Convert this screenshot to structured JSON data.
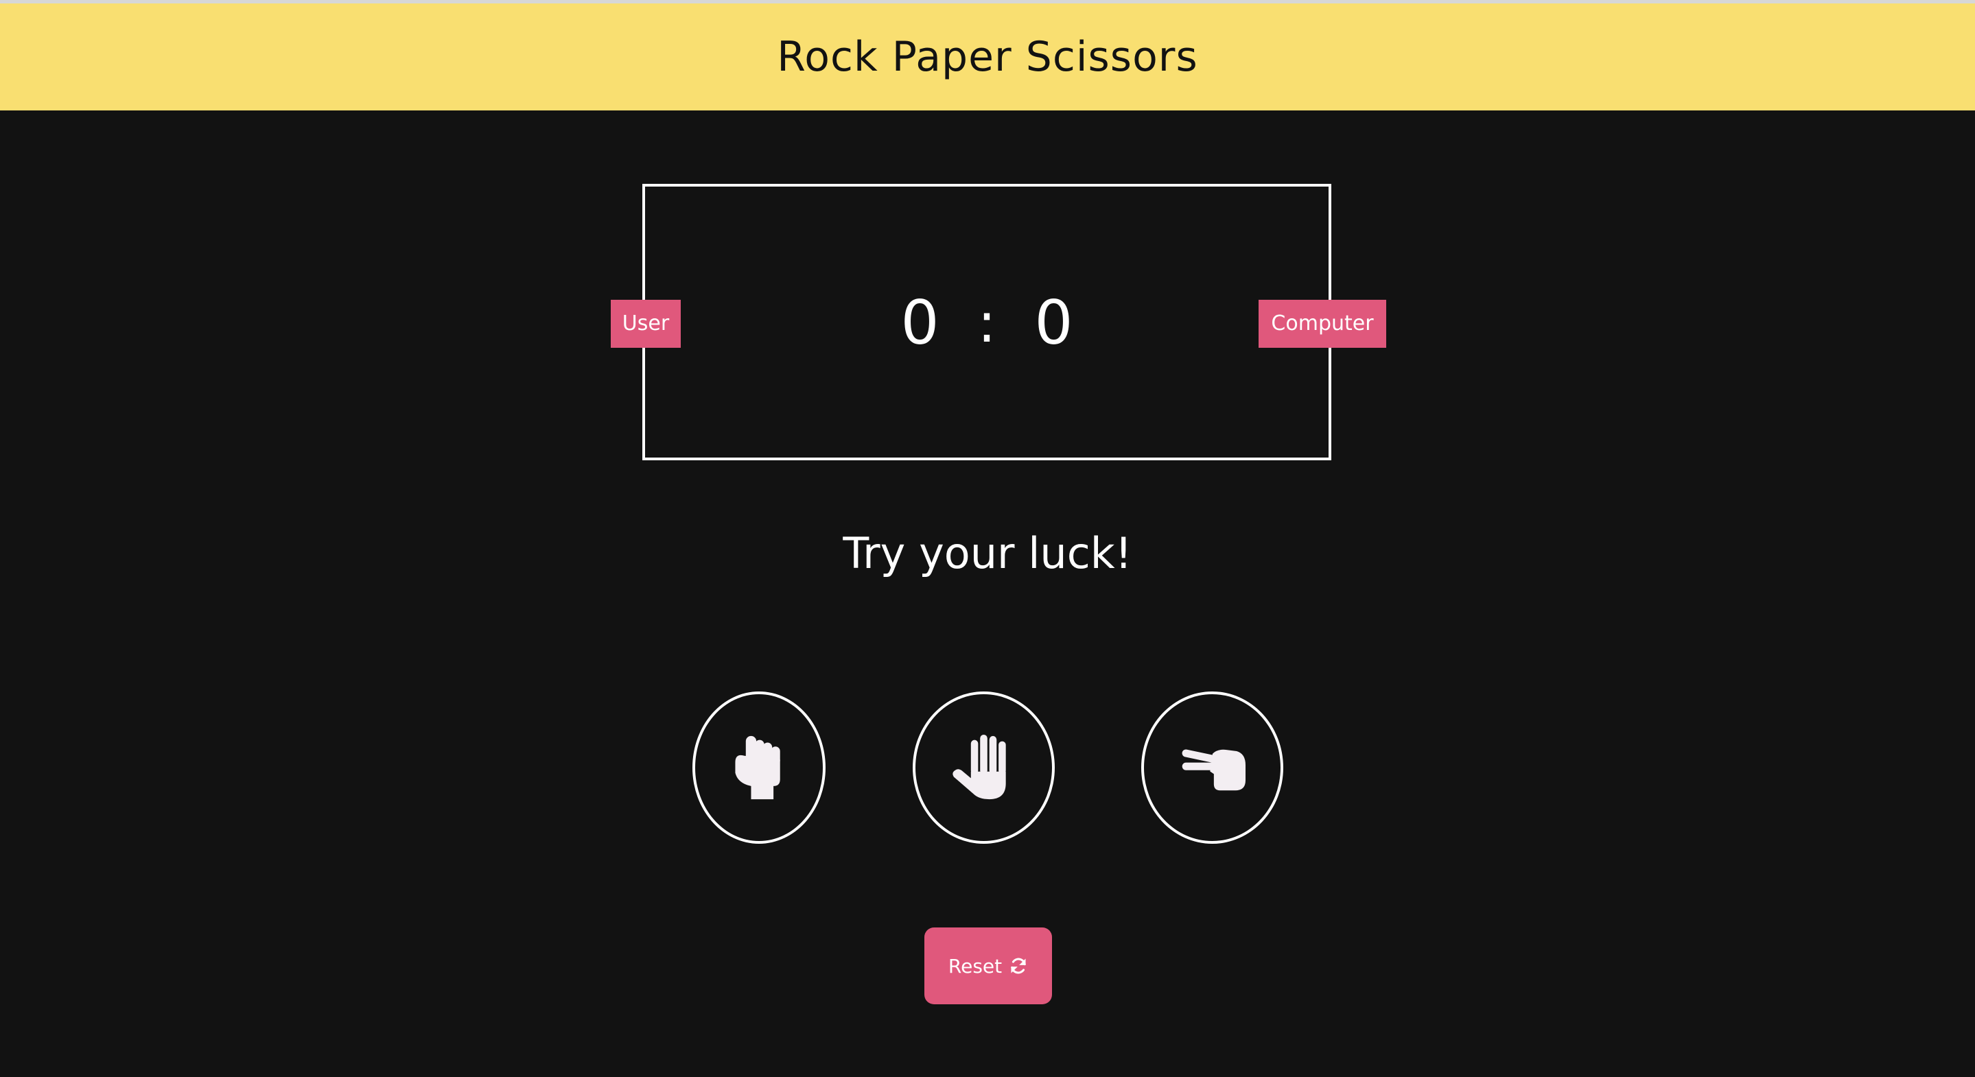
{
  "header": {
    "title": "Rock Paper Scissors"
  },
  "scoreboard": {
    "user_label": "User",
    "computer_label": "Computer",
    "user_score": "0",
    "separator": ":",
    "computer_score": "0"
  },
  "message": "Try your luck!",
  "choices": [
    {
      "name": "rock",
      "icon": "hand-rock-icon"
    },
    {
      "name": "paper",
      "icon": "hand-paper-icon"
    },
    {
      "name": "scissors",
      "icon": "hand-scissors-icon"
    }
  ],
  "reset": {
    "label": "Reset",
    "icon": "refresh-icon"
  },
  "colors": {
    "header_bg": "#f9df71",
    "page_bg": "#121212",
    "accent": "#e0587c",
    "foreground": "#ffffff"
  }
}
